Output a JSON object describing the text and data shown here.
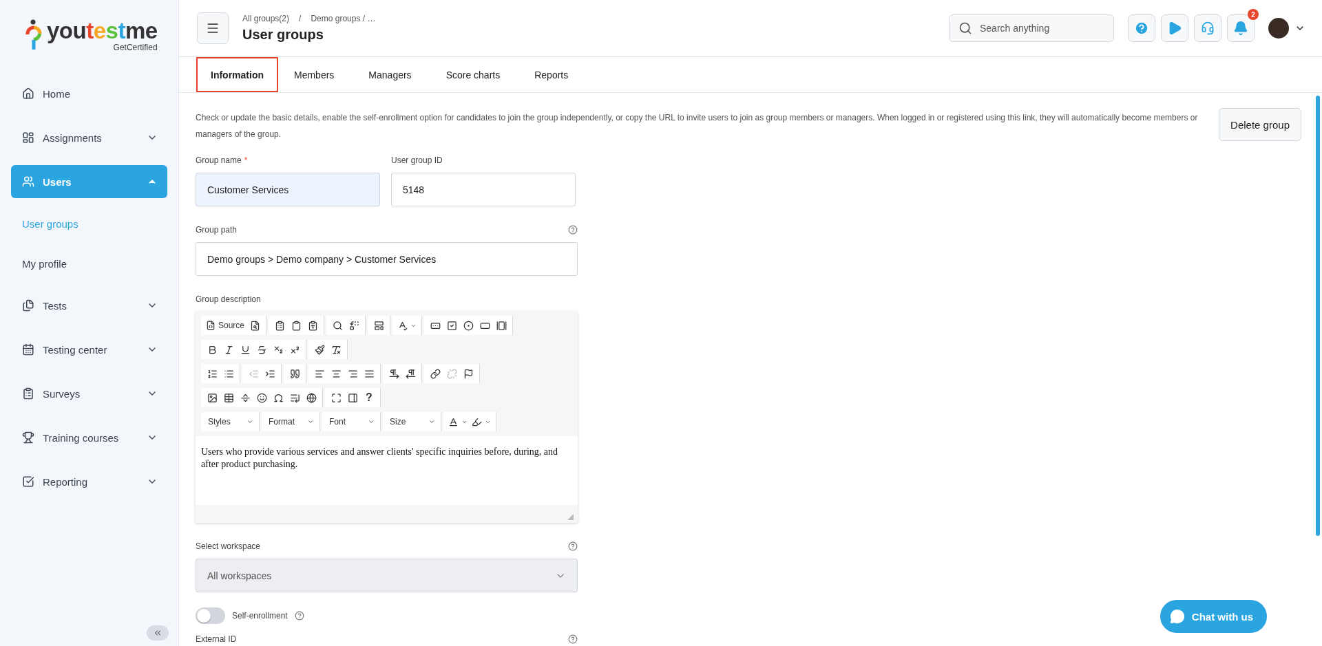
{
  "logo": {
    "parts": [
      {
        "text": "you",
        "color": "#333333"
      },
      {
        "text": "t",
        "color": "#e8452c"
      },
      {
        "text": "e",
        "color": "#f5a623"
      },
      {
        "text": "s",
        "color": "#5cc23e"
      },
      {
        "text": "t",
        "color": "#2ba5e0"
      },
      {
        "text": "me",
        "color": "#333333"
      }
    ],
    "tagline": "GetCertified"
  },
  "sidebar": {
    "items": [
      {
        "kind": "link",
        "label": "Home",
        "selected": false
      },
      {
        "kind": "menu",
        "label": "Assignments",
        "selected": false,
        "expanded": false
      },
      {
        "kind": "menu",
        "label": "Users",
        "selected": true,
        "expanded": true,
        "children": [
          {
            "label": "User groups",
            "selected": true
          },
          {
            "label": "My profile",
            "selected": false
          }
        ]
      },
      {
        "kind": "menu",
        "label": "Tests",
        "selected": false,
        "expanded": false
      },
      {
        "kind": "menu",
        "label": "Testing center",
        "selected": false,
        "expanded": false
      },
      {
        "kind": "menu",
        "label": "Surveys",
        "selected": false,
        "expanded": false
      },
      {
        "kind": "menu",
        "label": "Training courses",
        "selected": false,
        "expanded": false
      },
      {
        "kind": "menu",
        "label": "Reporting",
        "selected": false,
        "expanded": false
      }
    ]
  },
  "header": {
    "breadcrumb": [
      "All groups(2)",
      "Demo groups / …"
    ],
    "breadcrumb_separator": "/",
    "title": "User groups",
    "search": {
      "placeholder": "Search anything"
    },
    "notifications": "2"
  },
  "tabs": [
    {
      "label": "Information",
      "selected": true
    },
    {
      "label": "Members",
      "selected": false
    },
    {
      "label": "Managers",
      "selected": false
    },
    {
      "label": "Score charts",
      "selected": false
    },
    {
      "label": "Reports",
      "selected": false
    }
  ],
  "intro": "Check or update the basic details, enable the self-enrollment option for candidates to join the group independently, or copy the URL to invite users to join as group members or managers. When logged in or registered using this link, they will automatically become members or managers of the group.",
  "delete_button": "Delete group",
  "fields": [
    {
      "label": "Group name",
      "required_mark": "*",
      "value": "Customer Services",
      "highlighted": true
    },
    {
      "label": "User group ID",
      "value": "5148",
      "highlighted": false
    }
  ],
  "group_path": {
    "label": "Group path",
    "value": "Demo groups > Demo company > Customer Services"
  },
  "description": {
    "label": "Group description",
    "text": "Users who provide various services and answer clients' specific inquiries before, during, and after product purchasing.",
    "toolbar": [
      [
        [
          {
            "kind": "labeled",
            "label": "Source",
            "disabled": false
          },
          {
            "kind": "icon",
            "disabled": false
          }
        ],
        [
          {
            "kind": "icon",
            "disabled": false
          },
          {
            "kind": "icon",
            "disabled": false
          },
          {
            "kind": "icon",
            "disabled": false
          }
        ],
        [
          {
            "kind": "icon",
            "disabled": false
          },
          {
            "kind": "icon",
            "disabled": false
          }
        ],
        [
          {
            "kind": "icon",
            "disabled": false
          }
        ],
        [
          {
            "kind": "icon-menu",
            "disabled": false
          }
        ],
        [
          {
            "kind": "icon",
            "disabled": false
          },
          {
            "kind": "icon",
            "disabled": false
          },
          {
            "kind": "icon",
            "disabled": false
          },
          {
            "kind": "icon",
            "disabled": false
          },
          {
            "kind": "icon",
            "disabled": false
          }
        ]
      ],
      [
        [
          {
            "kind": "icon",
            "disabled": false
          },
          {
            "kind": "icon",
            "disabled": false
          },
          {
            "kind": "icon",
            "disabled": false
          },
          {
            "kind": "icon",
            "disabled": false
          },
          {
            "kind": "icon",
            "disabled": false
          },
          {
            "kind": "icon",
            "disabled": false
          }
        ],
        [
          {
            "kind": "icon",
            "disabled": false
          },
          {
            "kind": "icon",
            "disabled": false
          }
        ]
      ],
      [
        [
          {
            "kind": "icon",
            "disabled": false
          },
          {
            "kind": "icon",
            "disabled": false
          }
        ],
        [
          {
            "kind": "icon",
            "disabled": true
          },
          {
            "kind": "icon",
            "disabled": false
          }
        ],
        [
          {
            "kind": "icon",
            "disabled": false
          }
        ],
        [
          {
            "kind": "icon",
            "disabled": false
          },
          {
            "kind": "icon",
            "disabled": false
          },
          {
            "kind": "icon",
            "disabled": false
          },
          {
            "kind": "icon",
            "disabled": false
          }
        ],
        [
          {
            "kind": "icon",
            "disabled": false
          },
          {
            "kind": "icon",
            "disabled": false
          }
        ],
        [
          {
            "kind": "icon",
            "disabled": false
          },
          {
            "kind": "icon",
            "disabled": true
          },
          {
            "kind": "icon",
            "disabled": false
          }
        ]
      ],
      [
        [
          {
            "kind": "icon",
            "disabled": false
          },
          {
            "kind": "icon",
            "disabled": false
          },
          {
            "kind": "icon",
            "disabled": false
          },
          {
            "kind": "icon",
            "disabled": false
          },
          {
            "kind": "icon",
            "disabled": false
          },
          {
            "kind": "icon",
            "disabled": false
          },
          {
            "kind": "icon",
            "disabled": false
          }
        ],
        [
          {
            "kind": "icon",
            "disabled": false
          },
          {
            "kind": "icon",
            "disabled": false
          },
          {
            "kind": "text",
            "label": "?",
            "disabled": false
          }
        ]
      ],
      [
        [
          {
            "kind": "dropdown",
            "label": "Styles",
            "disabled": false
          }
        ],
        [
          {
            "kind": "dropdown",
            "label": "Format",
            "disabled": false
          }
        ],
        [
          {
            "kind": "dropdown",
            "label": "Font",
            "disabled": false
          }
        ],
        [
          {
            "kind": "dropdown",
            "label": "Size",
            "disabled": false
          }
        ],
        [
          {
            "kind": "color-menu",
            "disabled": false
          },
          {
            "kind": "color-menu",
            "disabled": false
          }
        ]
      ]
    ]
  },
  "workspace": {
    "label": "Select workspace",
    "value": "All workspaces",
    "disabled": true
  },
  "self_enrollment": {
    "label": "Self-enrollment",
    "on": false
  },
  "external_id": {
    "label": "External ID"
  },
  "chat_button": "Chat with us"
}
